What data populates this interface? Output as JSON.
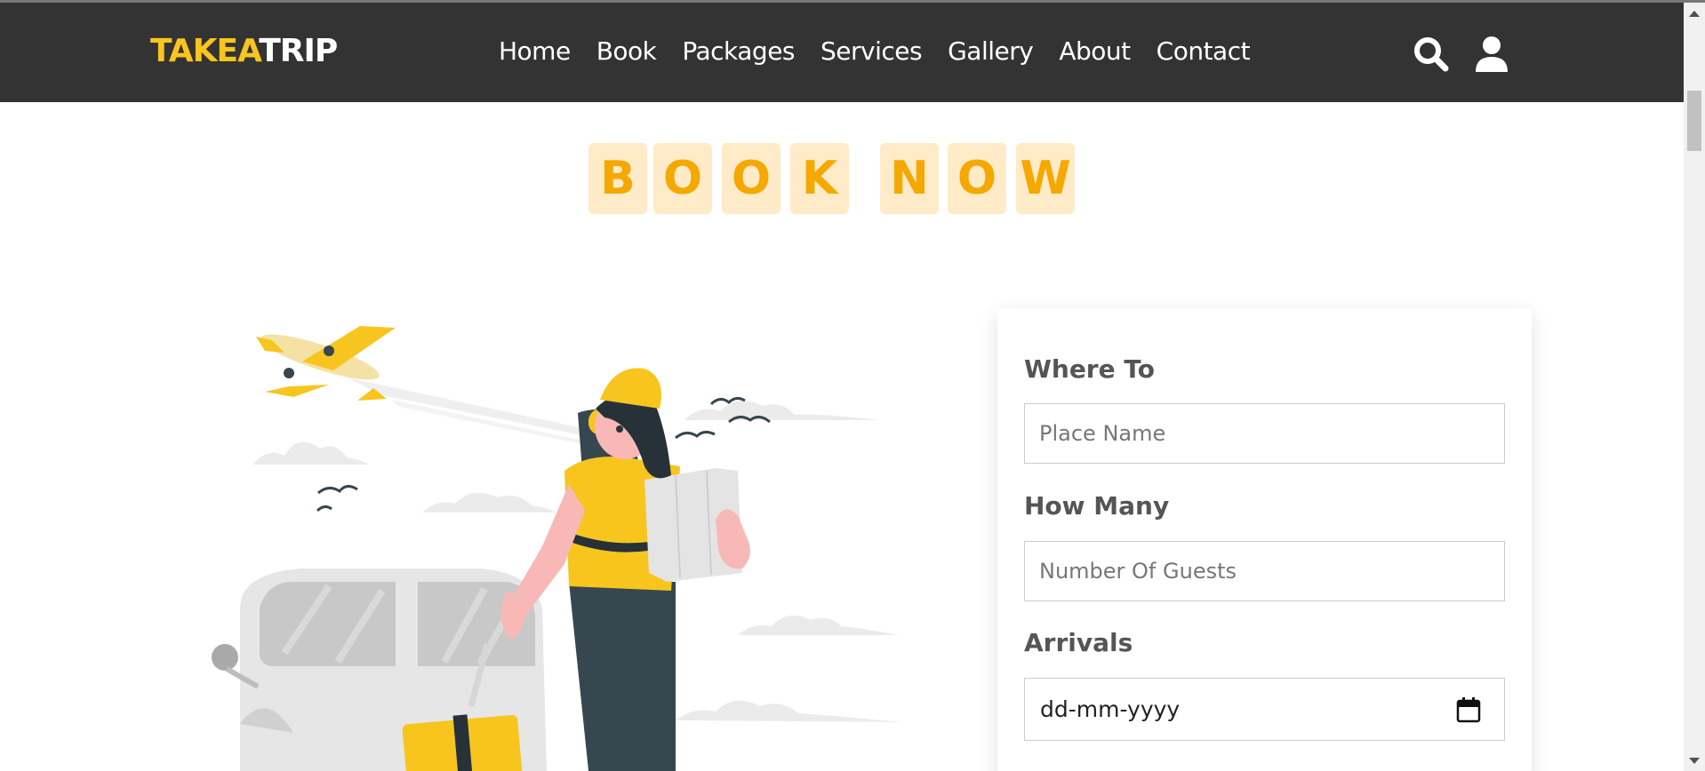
{
  "header": {
    "logo_part1": "TAKEA",
    "logo_part2": "TRIP",
    "nav": [
      "Home",
      "Book",
      "Packages",
      "Services",
      "Gallery",
      "About",
      "Contact"
    ],
    "icons": [
      "search-icon",
      "user-icon"
    ]
  },
  "section": {
    "heading_letters": [
      "B",
      "O",
      "O",
      "K",
      "N",
      "O",
      "W"
    ]
  },
  "form": {
    "where_label": "Where To",
    "where_placeholder": "Place Name",
    "guests_label": "How Many",
    "guests_placeholder": "Number Of Guests",
    "arrivals_label": "Arrivals",
    "arrivals_value": "dd-mm-yyyy"
  },
  "colors": {
    "header_bg": "#333333",
    "brand_yellow": "#f7c51e",
    "tile_bg": "#ffebc7",
    "tile_text": "#f5a800"
  }
}
